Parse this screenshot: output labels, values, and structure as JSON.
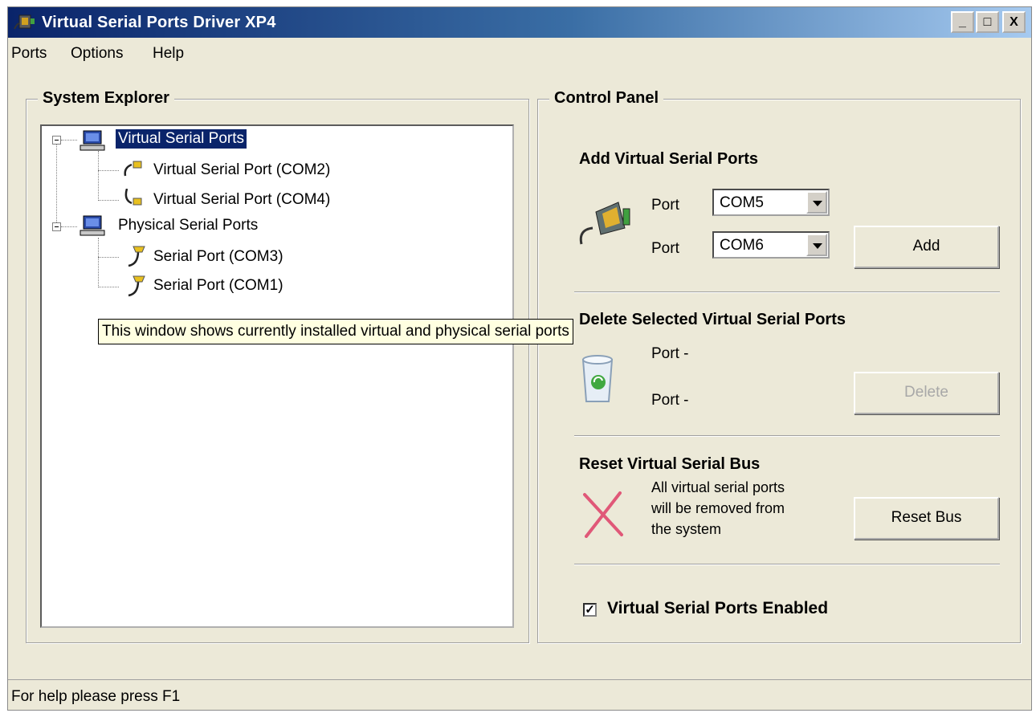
{
  "window": {
    "title": "Virtual Serial Ports Driver XP4",
    "icon": "app-serial-icon"
  },
  "title_buttons": {
    "minimize": "_",
    "maximize": "□",
    "close": "X"
  },
  "menu": [
    "Ports",
    "Options",
    "Help"
  ],
  "system_explorer": {
    "title": "System Explorer",
    "tree": [
      {
        "label": "Virtual Serial Ports",
        "icon": "computer-icon",
        "selected": true,
        "children": [
          {
            "label": "Virtual Serial Port (COM2)",
            "icon": "virtual-port-icon"
          },
          {
            "label": "Virtual Serial Port (COM4)",
            "icon": "virtual-port-icon"
          }
        ]
      },
      {
        "label": "Physical Serial Ports",
        "icon": "computer-icon",
        "selected": false,
        "children": [
          {
            "label": "Serial Port (COM3)",
            "icon": "serial-port-icon"
          },
          {
            "label": "Serial Port (COM1)",
            "icon": "serial-port-icon"
          }
        ]
      }
    ],
    "tooltip": "This window shows currently installed virtual and physical serial ports"
  },
  "control_panel": {
    "title": "Control Panel",
    "add": {
      "title": "Add Virtual Serial Ports",
      "port_label": "Port",
      "port1": "COM5",
      "port2": "COM6",
      "button": "Add"
    },
    "delete": {
      "title": "Delete Selected Virtual Serial Ports",
      "port1": "Port -",
      "port2": "Port -",
      "button": "Delete"
    },
    "reset": {
      "title": "Reset Virtual Serial Bus",
      "desc1": "All virtual serial ports",
      "desc2": "will be removed from",
      "desc3": "the system",
      "button": "Reset Bus"
    },
    "enabled": {
      "label": "Virtual Serial Ports Enabled",
      "checked": true,
      "mark": "✓"
    }
  },
  "status": "For help please press F1"
}
